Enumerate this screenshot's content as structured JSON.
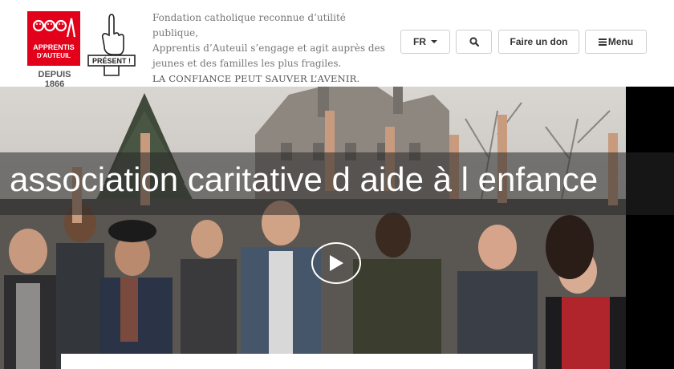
{
  "header": {
    "logo": {
      "line1": "APPRENTIS",
      "line2": "D'AUTEUIL",
      "since": "DEPUIS 1866"
    },
    "present_badge": "PRÉSENT !",
    "tagline": [
      "Fondation catholique reconnue d’utilité publique,",
      "Apprentis d’Auteuil s’engage et agit auprès des",
      "jeunes et des familles les plus fragiles.",
      "LA CONFIANCE PEUT SAUVER L’AVENIR."
    ],
    "lang_label": "FR",
    "donate_label": "Faire un don",
    "menu_label": "Menu"
  },
  "hero": {
    "title": "association caritative d aide à l enfance"
  },
  "icons": [
    "chevron-down-icon",
    "search-icon",
    "hamburger-icon",
    "play-icon"
  ],
  "colors": {
    "brand_red": "#e2001a",
    "overlay": "#282828"
  }
}
